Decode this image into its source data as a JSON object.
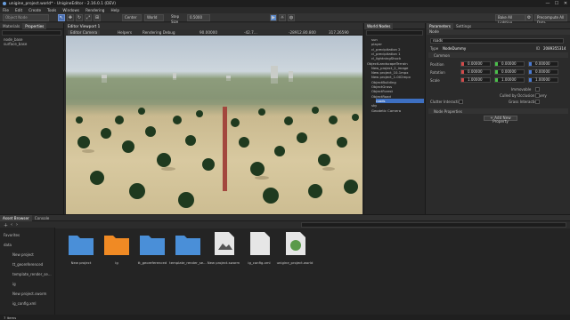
{
  "window": {
    "title": "unigine_project.world* - UnigineEditor - 2.16.0.1 (DEV)",
    "controls": [
      "—",
      "☐",
      "✕"
    ]
  },
  "menu": [
    "File",
    "Edit",
    "Create",
    "Tools",
    "Windows",
    "Rendering",
    "Help"
  ],
  "toolbar": {
    "search_placeholder": "Object Node",
    "center_label": "Center",
    "world_label": "World",
    "step_size_label": "Step Size",
    "step_size_value": "0.5000",
    "bake_lighting": "Bake All Lighting",
    "precompute": "Precompute All Data"
  },
  "left_panel": {
    "tabs": [
      "Materials",
      "Properties"
    ],
    "items": [
      "node_base",
      "surface_base"
    ]
  },
  "viewport": {
    "tab": "Editor Viewport 1",
    "camera": "Editor Camera",
    "helpers": "Helpers",
    "rendering_debug": "Rendering Debug",
    "fov": "90.00000",
    "coord_x": "-42.7...",
    "coord_y": "-28912.80.800",
    "coord_z": "317.26590"
  },
  "world_nodes": {
    "title": "World Nodes",
    "items": [
      {
        "label": "sun",
        "indent": 1,
        "selected": false
      },
      {
        "label": "player",
        "indent": 1,
        "selected": false
      },
      {
        "label": "cl_precipitation 2",
        "indent": 1,
        "selected": false
      },
      {
        "label": "cl_precipitation 1",
        "indent": 1,
        "selected": false
      },
      {
        "label": "cl_lightningShock",
        "indent": 1,
        "selected": false
      },
      {
        "label": "ObjectLandscapeTerrain",
        "indent": 0,
        "selected": false
      },
      {
        "label": "New_project_2_image",
        "indent": 1,
        "selected": false
      },
      {
        "label": "New project_10-1mpx",
        "indent": 1,
        "selected": false
      },
      {
        "label": "New project_1-002mpx",
        "indent": 1,
        "selected": false
      },
      {
        "label": "ObjectBuilding",
        "indent": 1,
        "selected": false
      },
      {
        "label": "ObjectGrass",
        "indent": 1,
        "selected": false
      },
      {
        "label": "ObjectForest",
        "indent": 1,
        "selected": false
      },
      {
        "label": "ObjectRoad",
        "indent": 1,
        "selected": false
      },
      {
        "label": "roads",
        "indent": 2,
        "selected": true
      },
      {
        "label": "sky",
        "indent": 1,
        "selected": false
      },
      {
        "label": "Geodetic Camera",
        "indent": 1,
        "selected": false
      }
    ]
  },
  "parameters": {
    "tabs": [
      "Parameters",
      "Settings"
    ],
    "subtab": "Node",
    "name_value": "roads",
    "type_label": "Type",
    "type_value": "NodeDummy",
    "id_label": "ID",
    "id_value": "2089355314",
    "section_common": "Common",
    "position_label": "Position",
    "rotation_label": "Rotation",
    "scale_label": "Scale",
    "position": [
      "0.00000",
      "0.00000",
      "0.00000"
    ],
    "rotation": [
      "0.00000",
      "0.00000",
      "0.00000"
    ],
    "scale": [
      "1.00000",
      "1.00000",
      "1.00000"
    ],
    "immovable": "Immovable",
    "culled": "Culled by Occlusion Query",
    "clutter": "Clutter Interaction",
    "grass": "Grass Interaction",
    "section_node_props": "Node Properties",
    "add_property": "+ Add New Property",
    "axis_colors": [
      "#d24a4a",
      "#4ac04a",
      "#4a7ad2"
    ]
  },
  "asset_browser": {
    "tabs": [
      "Asset Browser",
      "Console"
    ],
    "search_placeholder": "",
    "tree": [
      "Favorites",
      "data",
      "New project",
      "tt_georeferenced",
      "template_render_se...",
      "ig",
      "New project.sworm",
      "ig_config.xml"
    ],
    "assets": [
      {
        "label": "New project",
        "kind": "folder",
        "color": "#4a8fd8"
      },
      {
        "label": "ig",
        "kind": "folder",
        "color": "#f08a24"
      },
      {
        "label": "tt_georeferenced",
        "kind": "folder",
        "color": "#4a8fd8"
      },
      {
        "label": "template_render_se...",
        "kind": "folder",
        "color": "#4a8fd8"
      },
      {
        "label": "New project.sworm",
        "kind": "file-image",
        "color": "#e6e6e6"
      },
      {
        "label": "ig_config.xml",
        "kind": "file",
        "color": "#e6e6e6"
      },
      {
        "label": "unigine_project.world",
        "kind": "world",
        "color": "#e6e6e6"
      }
    ]
  },
  "status": {
    "text": "7 items"
  }
}
